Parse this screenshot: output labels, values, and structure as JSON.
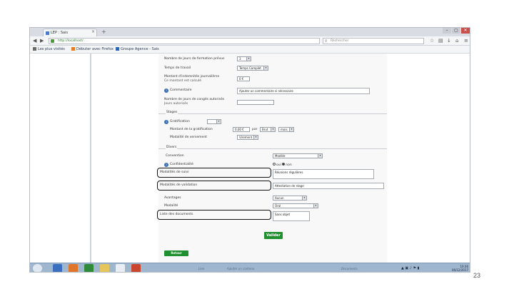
{
  "browser": {
    "tab_title": "LEP : Sais",
    "tab_close": "×",
    "new_tab": "+",
    "url": "http://localhost/",
    "url_path": "…",
    "search_placeholder": "Rechercher",
    "window_buttons": [
      "–",
      "▢",
      "✕"
    ]
  },
  "bookmarks": [
    {
      "label": "Les plus visités",
      "color": "#6b6b6b"
    },
    {
      "label": "Débuter avec Firefox",
      "color": "#e77b22"
    },
    {
      "label": "Groupe Agence - Sais",
      "color": "#2f64b5"
    }
  ],
  "form": {
    "row1_label": "Nombre de jours de formation prévus",
    "row1_value": "3",
    "row2_label": "Temps de travail",
    "row2_value": "Temps Complet",
    "row3_label": "Montant d'indemnités journalières",
    "row3_sub": "Ce montant est calculé",
    "row3_value": "0 €",
    "row4_label": "Commentaire",
    "row4_value": "Ajouter un commentaire si nécessaire",
    "row5_label": "Nombre de jours de congés autorisés",
    "row5_sub": "Jours autorisés",
    "section2_legend": "Stages",
    "row6_label": "Gratification",
    "row7_label": "Montant de la gratification",
    "row7_value": "0,00 €",
    "row7_unit": "par",
    "row7_period": "mois",
    "row7_currency": "Brut",
    "row8_label": "Modalité de versement",
    "row8_value": "Virement",
    "section3_legend": "Divers",
    "row9_label": "Convention",
    "row9_value": "Modèle",
    "row10_label": "Confidentialité",
    "row10_radio_yes": "oui",
    "row10_radio_no": "non",
    "row11_label": "Modalités de suivi",
    "row11_value": "Réunions régulières",
    "row12_label": "Modalités de validation",
    "row12_value": "Attestation de stage",
    "row13_label": "Avantages",
    "row13_value": "Aucun",
    "row14_label": "Modalité",
    "row14_value": "Oral",
    "row15_label": "Liste des documents",
    "row15_value": "Sans objet",
    "validate_button": "Valider",
    "back_button": "Retour"
  },
  "taskbar": {
    "time": "10:36",
    "date": "06/12/2017",
    "bottom_left": "Lien",
    "bottom_mid": "Ajouter un contenu",
    "bottom_right": "Documents"
  },
  "slide": {
    "page_number": "23"
  },
  "colors": {
    "accent_green": "#1f8f2f",
    "highlight_border": "#111111"
  }
}
